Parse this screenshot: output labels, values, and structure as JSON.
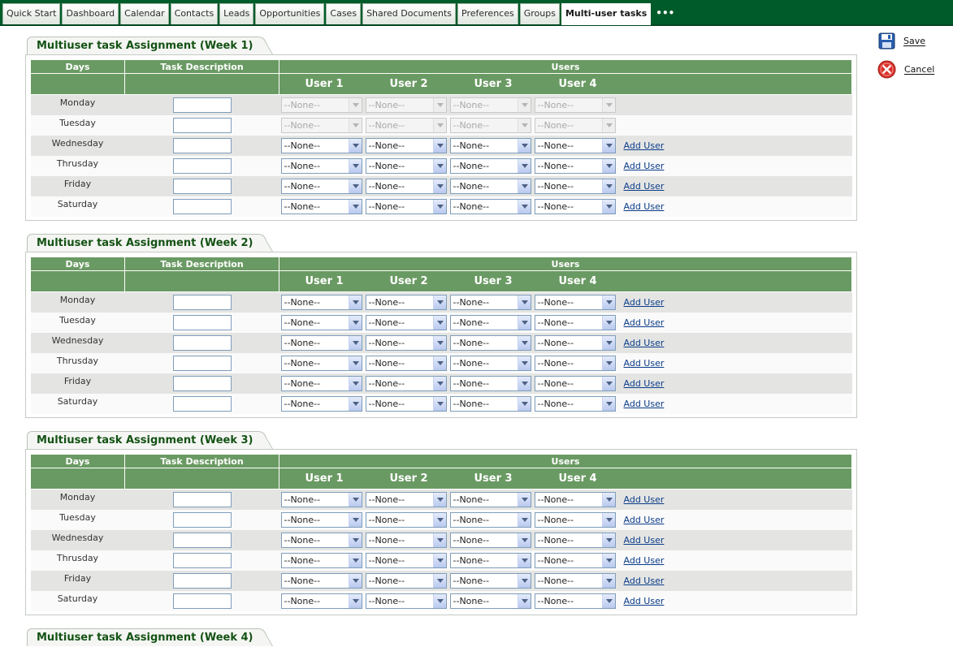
{
  "nav": {
    "tabs": [
      "Quick Start",
      "Dashboard",
      "Calendar",
      "Contacts",
      "Leads",
      "Opportunities",
      "Cases",
      "Shared Documents",
      "Preferences",
      "Groups",
      "Multi-user tasks"
    ],
    "active_tab": "Multi-user tasks",
    "more_label": "•••"
  },
  "actions": {
    "save_label": "Save",
    "cancel_label": "Cancel"
  },
  "table": {
    "col_days": "Days",
    "col_task": "Task Description",
    "col_users": "Users",
    "user_headers": [
      "User 1",
      "User 2",
      "User 3",
      "User 4"
    ],
    "select_default": "--None--",
    "add_user_label": "Add User"
  },
  "weeks": [
    {
      "title": "Multiuser task Assignment (Week 1)",
      "rows": [
        {
          "day": "Monday",
          "task": "",
          "users": [
            "--None--",
            "--None--",
            "--None--",
            "--None--"
          ],
          "disabled": true,
          "add_user": false
        },
        {
          "day": "Tuesday",
          "task": "",
          "users": [
            "--None--",
            "--None--",
            "--None--",
            "--None--"
          ],
          "disabled": true,
          "add_user": false
        },
        {
          "day": "Wednesday",
          "task": "",
          "users": [
            "--None--",
            "--None--",
            "--None--",
            "--None--"
          ],
          "disabled": false,
          "add_user": true
        },
        {
          "day": "Thrusday",
          "task": "",
          "users": [
            "--None--",
            "--None--",
            "--None--",
            "--None--"
          ],
          "disabled": false,
          "add_user": true
        },
        {
          "day": "Friday",
          "task": "",
          "users": [
            "--None--",
            "--None--",
            "--None--",
            "--None--"
          ],
          "disabled": false,
          "add_user": true
        },
        {
          "day": "Saturday",
          "task": "",
          "users": [
            "--None--",
            "--None--",
            "--None--",
            "--None--"
          ],
          "disabled": false,
          "add_user": true
        }
      ]
    },
    {
      "title": "Multiuser task Assignment (Week 2)",
      "rows": [
        {
          "day": "Monday",
          "task": "",
          "users": [
            "--None--",
            "--None--",
            "--None--",
            "--None--"
          ],
          "disabled": false,
          "add_user": true
        },
        {
          "day": "Tuesday",
          "task": "",
          "users": [
            "--None--",
            "--None--",
            "--None--",
            "--None--"
          ],
          "disabled": false,
          "add_user": true
        },
        {
          "day": "Wednesday",
          "task": "",
          "users": [
            "--None--",
            "--None--",
            "--None--",
            "--None--"
          ],
          "disabled": false,
          "add_user": true
        },
        {
          "day": "Thrusday",
          "task": "",
          "users": [
            "--None--",
            "--None--",
            "--None--",
            "--None--"
          ],
          "disabled": false,
          "add_user": true
        },
        {
          "day": "Friday",
          "task": "",
          "users": [
            "--None--",
            "--None--",
            "--None--",
            "--None--"
          ],
          "disabled": false,
          "add_user": true
        },
        {
          "day": "Saturday",
          "task": "",
          "users": [
            "--None--",
            "--None--",
            "--None--",
            "--None--"
          ],
          "disabled": false,
          "add_user": true
        }
      ]
    },
    {
      "title": "Multiuser task Assignment (Week 3)",
      "rows": [
        {
          "day": "Monday",
          "task": "",
          "users": [
            "--None--",
            "--None--",
            "--None--",
            "--None--"
          ],
          "disabled": false,
          "add_user": true
        },
        {
          "day": "Tuesday",
          "task": "",
          "users": [
            "--None--",
            "--None--",
            "--None--",
            "--None--"
          ],
          "disabled": false,
          "add_user": true
        },
        {
          "day": "Wednesday",
          "task": "",
          "users": [
            "--None--",
            "--None--",
            "--None--",
            "--None--"
          ],
          "disabled": false,
          "add_user": true
        },
        {
          "day": "Thrusday",
          "task": "",
          "users": [
            "--None--",
            "--None--",
            "--None--",
            "--None--"
          ],
          "disabled": false,
          "add_user": true
        },
        {
          "day": "Friday",
          "task": "",
          "users": [
            "--None--",
            "--None--",
            "--None--",
            "--None--"
          ],
          "disabled": false,
          "add_user": true
        },
        {
          "day": "Saturday",
          "task": "",
          "users": [
            "--None--",
            "--None--",
            "--None--",
            "--None--"
          ],
          "disabled": false,
          "add_user": true
        }
      ]
    },
    {
      "title": "Multiuser task Assignment (Week 4)",
      "rows": []
    }
  ]
}
